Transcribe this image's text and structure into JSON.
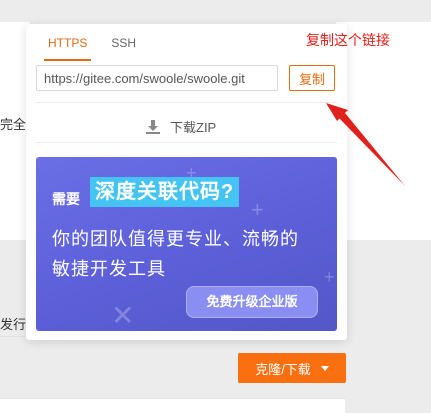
{
  "background": {
    "left_text_1": "完全",
    "left_text_2": "发行"
  },
  "popover": {
    "tabs": [
      {
        "label": "HTTPS",
        "active": true
      },
      {
        "label": "SSH",
        "active": false
      }
    ],
    "url_value": "https://gitee.com/swoole/swoole.git",
    "copy_label": "复制",
    "download_zip_label": "下载ZIP",
    "download_icon": "download-icon"
  },
  "banner": {
    "prefix": "需要",
    "highlight": "深度关联代码?",
    "line1": "你的团队值得更专业、流畅的",
    "line2": "敏捷开发工具",
    "cta": "免费升级企业版"
  },
  "annotation": {
    "text": "复制这个链接",
    "color": "#e0201a"
  },
  "clone_button": {
    "label": "克隆/下载"
  },
  "colors": {
    "accent": "#e36a11",
    "clone_bg": "#fa7011",
    "banner_bg": "#5c5fd8",
    "banner_highlight": "#45c4f3"
  }
}
